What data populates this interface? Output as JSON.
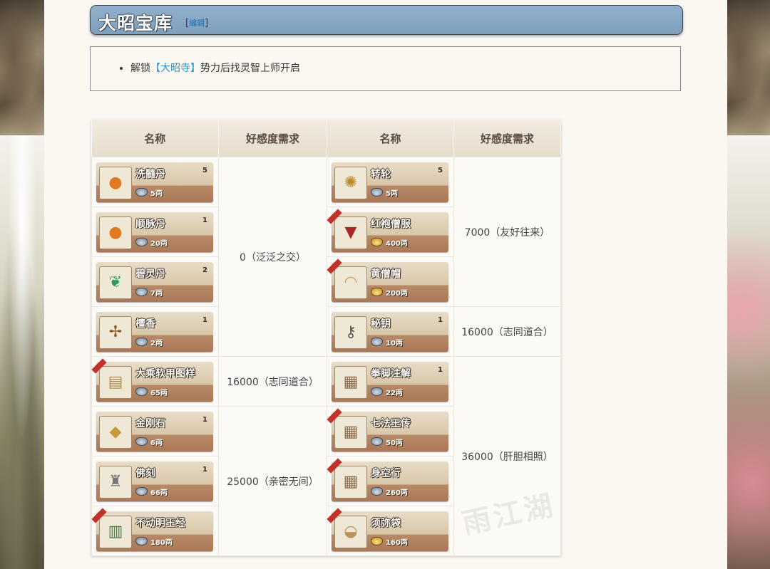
{
  "title": "大昭宝库",
  "edit_label": "编辑",
  "info": {
    "prefix": "解锁",
    "highlight": "【大昭寺】",
    "suffix": "势力后找灵智上师开启"
  },
  "columns": [
    "名称",
    "好感度需求",
    "名称",
    "好感度需求"
  ],
  "currency": {
    "silver": "silver-coin-icon",
    "gold": "gold-coin-icon"
  },
  "left_items": [
    {
      "name": "洗髓丹",
      "count": "5",
      "price": "5两",
      "coin": "silver",
      "icon": "dan-icon",
      "ribbon": false
    },
    {
      "name": "顺脉丹",
      "count": "1",
      "price": "20两",
      "coin": "silver",
      "icon": "dan-icon",
      "ribbon": false
    },
    {
      "name": "碧灵丹",
      "count": "2",
      "price": "7两",
      "coin": "silver",
      "icon": "leaf-icon",
      "ribbon": false
    },
    {
      "name": "檀香",
      "count": "1",
      "price": "2两",
      "coin": "silver",
      "icon": "incense-icon",
      "ribbon": false
    },
    {
      "name": "大乘软甲图样",
      "count": "",
      "price": "65两",
      "coin": "silver",
      "icon": "scroll-icon",
      "ribbon": true
    },
    {
      "name": "金刚石",
      "count": "1",
      "price": "6两",
      "coin": "silver",
      "icon": "stone-icon",
      "ribbon": false
    },
    {
      "name": "佛刻",
      "count": "1",
      "price": "66两",
      "coin": "silver",
      "icon": "statue-icon",
      "ribbon": false
    },
    {
      "name": "不动明王经",
      "count": "",
      "price": "180两",
      "coin": "silver",
      "icon": "sutra-icon",
      "ribbon": true
    }
  ],
  "right_items": [
    {
      "name": "转轮",
      "count": "5",
      "price": "5两",
      "coin": "silver",
      "icon": "wheel-icon",
      "ribbon": false
    },
    {
      "name": "红袍僧服",
      "count": "",
      "price": "400两",
      "coin": "gold",
      "icon": "robe-icon",
      "ribbon": true
    },
    {
      "name": "黄僧帽",
      "count": "",
      "price": "200两",
      "coin": "gold",
      "icon": "hat-icon",
      "ribbon": true
    },
    {
      "name": "秘钥",
      "count": "1",
      "price": "10两",
      "coin": "silver",
      "icon": "key-icon",
      "ribbon": false
    },
    {
      "name": "拳脚注解",
      "count": "1",
      "price": "22两",
      "coin": "silver",
      "icon": "book-icon",
      "ribbon": false
    },
    {
      "name": "七法王传",
      "count": "",
      "price": "50两",
      "coin": "silver",
      "icon": "book-icon",
      "ribbon": true
    },
    {
      "name": "身空行",
      "count": "",
      "price": "260两",
      "coin": "silver",
      "icon": "book-icon",
      "ribbon": true
    },
    {
      "name": "须弥袋",
      "count": "",
      "price": "160两",
      "coin": "gold",
      "icon": "bag-icon",
      "ribbon": true
    }
  ],
  "left_requirements": [
    "0（泛泛之交）",
    "16000（志同道合）",
    "25000（亲密无间）"
  ],
  "right_requirements": [
    "7000（友好往来）",
    "16000（志同道合）",
    "36000（肝胆相照）"
  ],
  "watermark": "雨江湖"
}
